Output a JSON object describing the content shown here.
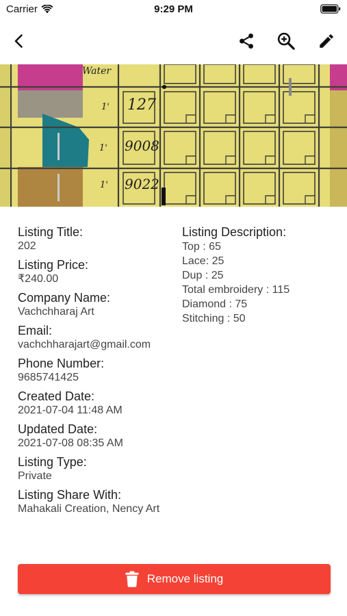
{
  "status_bar": {
    "carrier": "Carrier",
    "time": "9:29 PM"
  },
  "nav": {
    "icons": [
      "back-icon",
      "share-icon",
      "zoom-in-icon",
      "edit-icon"
    ]
  },
  "listing": {
    "title_label": "Listing Title:",
    "title_value": "202",
    "price_label": "Listing Price:",
    "price_value": "₹240.00",
    "company_label": "Company Name:",
    "company_value": "Vachchharaj Art",
    "email_label": "Email:",
    "email_value": "vachchharajart@gmail.com",
    "phone_label": "Phone Number:",
    "phone_value": "9685741425",
    "created_label": "Created Date:",
    "created_value": "2021-07-04 11:48 AM",
    "updated_label": "Updated Date:",
    "updated_value": "2021-07-08 08:35 AM",
    "type_label": "Listing Type:",
    "type_value": "Private",
    "share_label": "Listing Share With:",
    "share_value": "Mahakali Creation, Nency Art",
    "description_label": "Listing Description:",
    "description_lines": [
      "Top : 65",
      "Lace: 25",
      "Dup : 25",
      "Total embroidery : 115",
      "Diamond : 75",
      "Stitching : 50"
    ]
  },
  "photo": {
    "handwritten": [
      "Water",
      "1'",
      "127",
      "1'",
      "9008",
      "1'",
      "9022"
    ]
  },
  "actions": {
    "remove_label": "Remove listing"
  },
  "colors": {
    "remove_button": "#f44336",
    "board_yellow": "#e9e07e"
  }
}
